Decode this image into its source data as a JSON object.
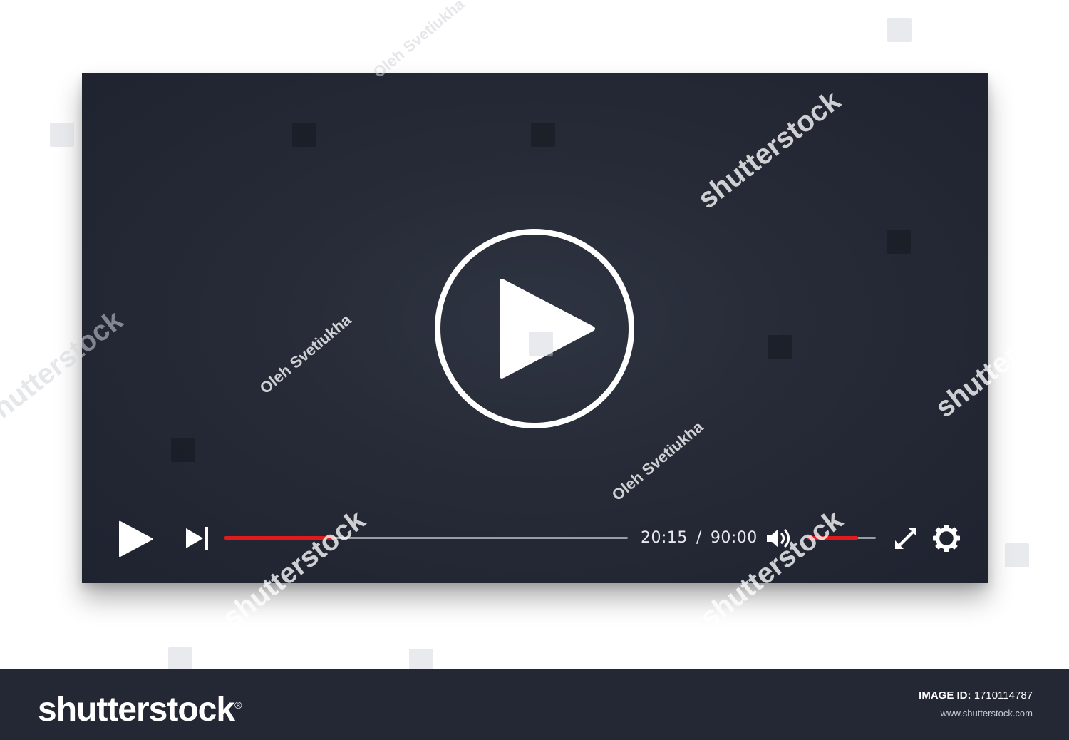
{
  "player": {
    "current_time": "20:15",
    "separator": "/",
    "total_time": "90:00",
    "progress_fraction": 0.27,
    "volume_fraction": 0.74,
    "icons": {
      "big_play": "play-circle-icon",
      "play": "play-icon",
      "next": "skip-next-icon",
      "volume": "volume-icon",
      "fullscreen": "fullscreen-icon",
      "settings": "gear-icon"
    },
    "colors": {
      "background": "#272b37",
      "progress": "#e01b1b",
      "track": "#9a9ca4",
      "icon": "#ffffff"
    }
  },
  "watermark": {
    "brand": "shutterstock",
    "author": "Oleh Svetiukha"
  },
  "footer": {
    "brand": "shutterstock",
    "brand_symbol": "®",
    "image_id_label": "IMAGE ID:",
    "image_id": "1710114787",
    "site_url": "www.shutterstock.com"
  }
}
